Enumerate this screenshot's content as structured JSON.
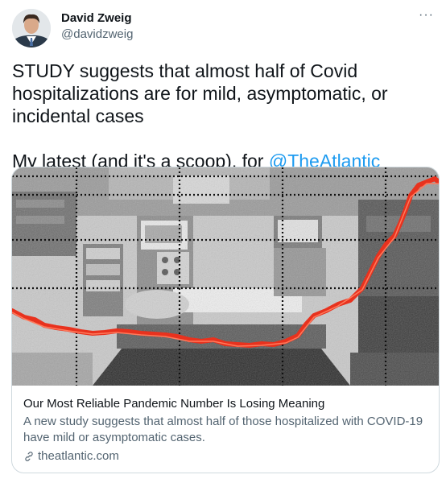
{
  "author": {
    "name": "David Zweig",
    "handle": "@davidzweig",
    "avatar_icon": "profile-photo"
  },
  "more_icon": "more-options-icon",
  "tweet": {
    "line1": "STUDY suggests that almost half of Covid",
    "line2": "hospitalizations are for mild, asymptomatic, or",
    "line3": "incidental cases",
    "line4_prefix": "My latest (and it's a scoop), for ",
    "mention": "@TheAtlantic"
  },
  "card": {
    "title": "Our Most Reliable Pandemic Number Is Losing Meaning",
    "description": "A new study suggests that almost half of those hospitalized with COVID-19 have mild or asymptomatic cases.",
    "domain": "theatlantic.com",
    "link_icon": "link-icon",
    "image": {
      "subject": "hospital-room-photo",
      "overlay_line_color": "#e8321e",
      "grid_style": "dotted"
    }
  },
  "colors": {
    "link": "#1d9bf0",
    "text": "#0f1419",
    "secondary": "#536471",
    "border": "#cfd9de"
  }
}
